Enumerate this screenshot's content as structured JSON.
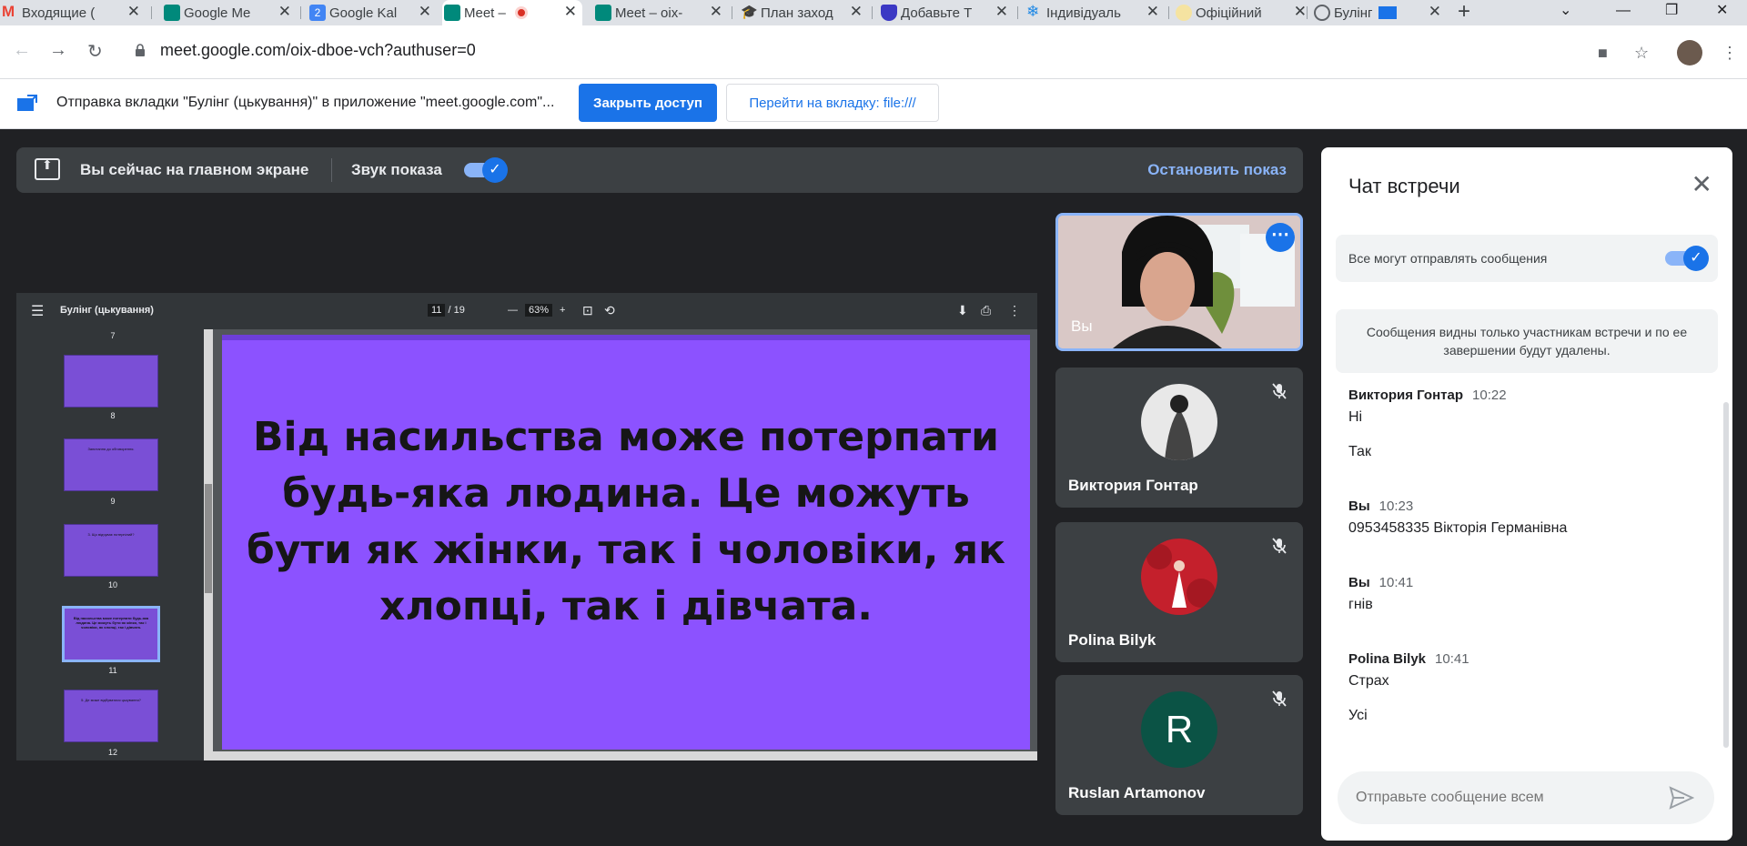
{
  "browser": {
    "tabs": [
      {
        "label": "Входящие (",
        "icon": "gmail-icon",
        "color": "#ea4335"
      },
      {
        "label": "Google Me",
        "icon": "meet-icon",
        "color": "#00897b"
      },
      {
        "label": "Google Kal",
        "icon": "calendar-icon",
        "color": "#4285f4"
      },
      {
        "label": "Meet –",
        "icon": "meet-icon",
        "color": "#00897b",
        "active": true
      },
      {
        "label": "Meet – oix-",
        "icon": "meet-icon",
        "color": "#00897b"
      },
      {
        "label": "План заход",
        "icon": "graduation-cap-icon",
        "color": "#202124"
      },
      {
        "label": "Добавьте Т",
        "icon": "shield-icon",
        "color": "#3b38c4"
      },
      {
        "label": "Індивідуаль",
        "icon": "snowflake-icon",
        "color": "#1e88e5"
      },
      {
        "label": "Офіційний",
        "icon": "emblem-icon",
        "color": "#c9a227"
      },
      {
        "label": "Булінг",
        "icon": "globe-icon",
        "color": "#5f6368"
      }
    ],
    "url": "meet.google.com/oix-dboe-vch?authuser=0"
  },
  "infobar": {
    "text": "Отправка вкладки \"Булінг (цькування)\" в приложение \"meet.google.com\"...",
    "close_access": "Закрыть доступ",
    "go_to_tab": "Перейти на вкладку: file:///"
  },
  "presenting": {
    "status": "Вы сейчас на главном экране",
    "sound": "Звук показа",
    "stop": "Остановить показ"
  },
  "pdf": {
    "title": "Булінг (цькування)",
    "page_current": "11",
    "page_total": "/ 19",
    "zoom": "63%",
    "thumb_numbers": [
      "7",
      "8",
      "9",
      "10",
      "11",
      "12"
    ],
    "thumb_texts": [
      "",
      "Запитання до обговорення.",
      "3. Що відчуває потерпілий?",
      "Від насильства може потерпати будь-яка людина. Це можуть бути як жінки, так і чоловіки, як хлопці, так і дівчата.",
      "5. Де може відбуватися цькування?"
    ],
    "slide_lines": [
      "Від насильства може потерпати",
      "будь-яка людина. Це можуть",
      "бути як жінки, так і чоловіки, як",
      "хлопці, так і дівчата."
    ]
  },
  "participants": [
    {
      "name": "Вы"
    },
    {
      "name": "Виктория Гонтар"
    },
    {
      "name": "Polina Bilyk"
    },
    {
      "name": "Ruslan Artamonov",
      "initial": "R"
    }
  ],
  "chat": {
    "title": "Чат встречи",
    "permission": "Все могут отправлять сообщения",
    "notice": "Сообщения видны только участникам встречи и по ее завершении будут удалены.",
    "messages": [
      {
        "author": "Виктория Гонтар",
        "time": "10:22",
        "lines": [
          "Ні",
          "Так"
        ]
      },
      {
        "author": "Вы",
        "time": "10:23",
        "lines": [
          "0953458335 Вікторія Германівна"
        ]
      },
      {
        "author": "Вы",
        "time": "10:41",
        "lines": [
          "гнів"
        ]
      },
      {
        "author": "Polina Bilyk",
        "time": "10:41",
        "lines": [
          "Страх",
          "Усі"
        ]
      }
    ],
    "input_placeholder": "Отправьте сообщение всем"
  }
}
